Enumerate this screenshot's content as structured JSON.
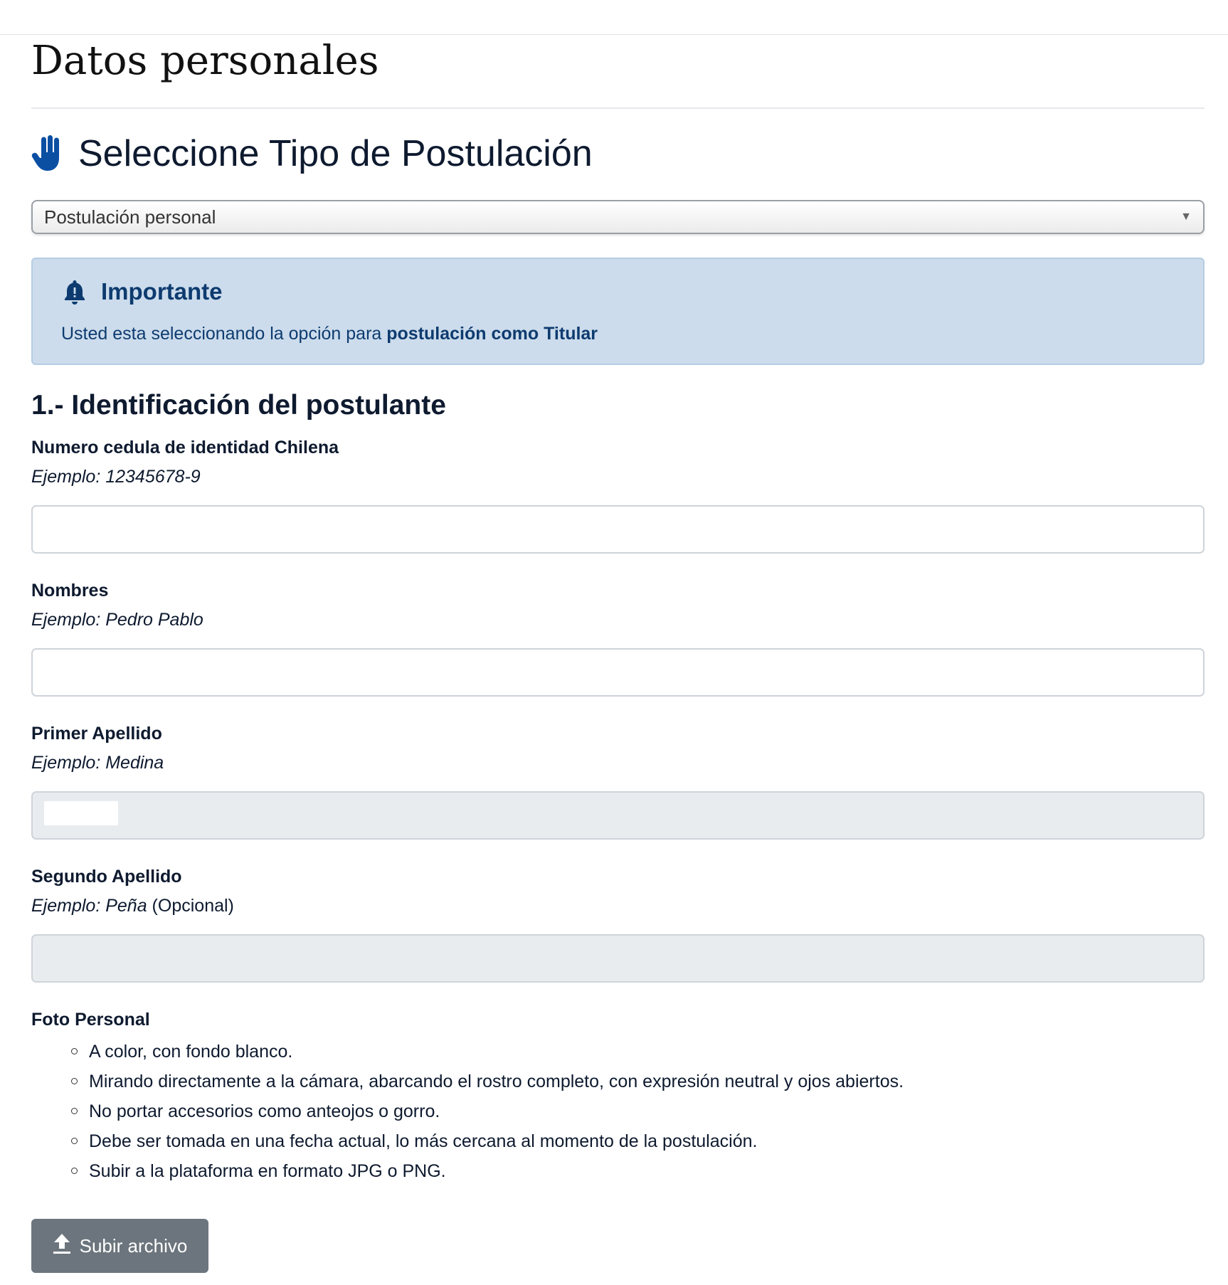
{
  "page": {
    "title": "Datos personales"
  },
  "application_type": {
    "heading": "Seleccione Tipo de Postulación",
    "icon": "hand-icon",
    "select_value": "Postulación personal"
  },
  "alert": {
    "icon": "bell-icon",
    "title": "Importante",
    "text_prefix": "Usted esta seleccionando la opción para ",
    "text_strong": "postulación como Titular",
    "background_color": "#ccdcec",
    "text_color": "#0e3b6f"
  },
  "identification": {
    "title": "1.- Identificación del postulante",
    "fields": [
      {
        "label": "Numero cedula de identidad Chilena",
        "hint": "Ejemplo: 12345678-9",
        "hint_suffix": "",
        "value": "",
        "disabled": false
      },
      {
        "label": "Nombres",
        "hint": "Ejemplo: Pedro Pablo",
        "hint_suffix": "",
        "value": "",
        "disabled": false
      },
      {
        "label": "Primer Apellido",
        "hint": "Ejemplo: Medina",
        "hint_suffix": "",
        "value": "",
        "disabled": true
      },
      {
        "label": "Segundo Apellido",
        "hint": "Ejemplo: Peña",
        "hint_suffix": " (Opcional)",
        "value": "",
        "disabled": true
      }
    ]
  },
  "photo": {
    "label": "Foto Personal",
    "requirements": [
      "A color, con fondo blanco.",
      "Mirando directamente a la cámara, abarcando el rostro completo, con expresión neutral y ojos abiertos.",
      "No portar accesorios como anteojos o gorro.",
      "Debe ser tomada en una fecha actual, lo más cercana al momento de la postulación.",
      "Subir a la plataforma en formato JPG o PNG."
    ],
    "upload_button_label": "Subir archivo",
    "upload_icon": "upload-icon",
    "button_color": "#6c757d"
  }
}
